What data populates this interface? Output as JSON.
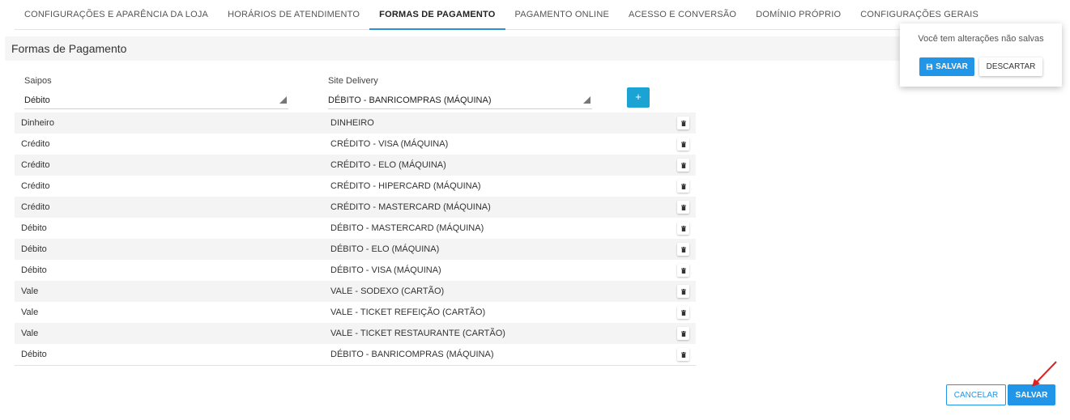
{
  "tabs": [
    {
      "label": "CONFIGURAÇÕES E APARÊNCIA DA LOJA"
    },
    {
      "label": "HORÁRIOS DE ATENDIMENTO"
    },
    {
      "label": "FORMAS DE PAGAMENTO"
    },
    {
      "label": "PAGAMENTO ONLINE"
    },
    {
      "label": "ACESSO E CONVERSÃO"
    },
    {
      "label": "DOMÍNIO PRÓPRIO"
    },
    {
      "label": "CONFIGURAÇÕES GERAIS"
    }
  ],
  "active_tab": "FORMAS DE PAGAMENTO",
  "section": {
    "title": "Formas de Pagamento"
  },
  "form": {
    "saipos_label": "Saipos",
    "saipos_value": "Débito",
    "site_label": "Site Delivery",
    "site_value": "DÉBITO - BANRICOMPRAS (MÁQUINA)",
    "add_label": "+"
  },
  "rows": [
    {
      "saipos": "Dinheiro",
      "site": "DINHEIRO"
    },
    {
      "saipos": "Crédito",
      "site": "CRÉDITO - VISA (MÁQUINA)"
    },
    {
      "saipos": "Crédito",
      "site": "CRÉDITO - ELO (MÁQUINA)"
    },
    {
      "saipos": "Crédito",
      "site": "CRÉDITO - HIPERCARD (MÁQUINA)"
    },
    {
      "saipos": "Crédito",
      "site": "CRÉDITO - MASTERCARD (MÁQUINA)"
    },
    {
      "saipos": "Débito",
      "site": "DÉBITO - MASTERCARD (MÁQUINA)"
    },
    {
      "saipos": "Débito",
      "site": "DÉBITO - ELO (MÁQUINA)"
    },
    {
      "saipos": "Débito",
      "site": "DÉBITO - VISA (MÁQUINA)"
    },
    {
      "saipos": "Vale",
      "site": "VALE - SODEXO (CARTÃO)"
    },
    {
      "saipos": "Vale",
      "site": "VALE - TICKET REFEIÇÃO (CARTÃO)"
    },
    {
      "saipos": "Vale",
      "site": "VALE - TICKET RESTAURANTE (CARTÃO)"
    },
    {
      "saipos": "Débito",
      "site": "DÉBITO - BANRICOMPRAS (MÁQUINA)"
    }
  ],
  "popup": {
    "message": "Você tem alterações não salvas",
    "save_label": "SALVAR",
    "discard_label": "DESCARTAR"
  },
  "footer": {
    "cancel_label": "CANCELAR",
    "save_label": "SALVAR"
  },
  "colors": {
    "accent": "#2196e8",
    "add_button": "#1ba3d4",
    "annotation_arrow": "#e02020"
  }
}
